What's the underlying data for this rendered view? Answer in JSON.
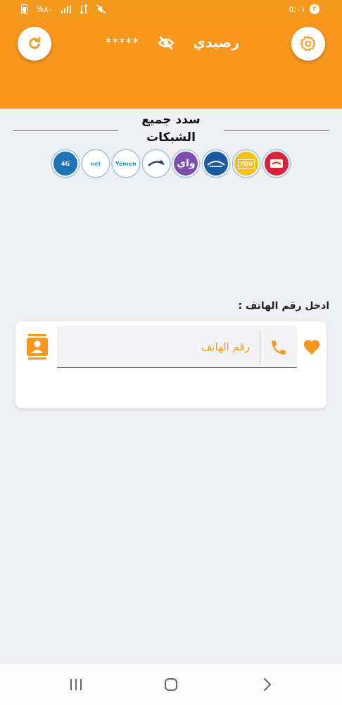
{
  "status_bar": {
    "battery_text": "%٨٠",
    "time": "٥:٠١",
    "sim_slot": "٢"
  },
  "header": {
    "title": "رصيدي",
    "balance_mask": "*****",
    "refresh_icon": "refresh-icon",
    "settings_icon": "gear-icon",
    "visibility_icon": "eye-off-icon"
  },
  "networks_section": {
    "title": "سدد جميع الشبكات",
    "items": [
      {
        "name": "yemen-4g",
        "label": "4G",
        "color": "#1f74b8"
      },
      {
        "name": "network-2",
        "label": "net",
        "color": "#3aa6d9"
      },
      {
        "name": "yemen-net",
        "label": "Yemen",
        "color": "#2893cf"
      },
      {
        "name": "network-4",
        "label": "",
        "color": "#263b7a"
      },
      {
        "name": "way",
        "label": "واي",
        "color": "#7b4fb0"
      },
      {
        "name": "network-6",
        "label": "",
        "color": "#1a5aa0"
      },
      {
        "name": "you",
        "label": "YOU",
        "color": "#f2c21a"
      },
      {
        "name": "sabafon",
        "label": "",
        "color": "#d9233d"
      }
    ]
  },
  "phone_entry": {
    "label": "ادخل رقم الهاتف :",
    "placeholder": "رقم الهاتف",
    "value": ""
  },
  "colors": {
    "accent": "#f8961e"
  }
}
